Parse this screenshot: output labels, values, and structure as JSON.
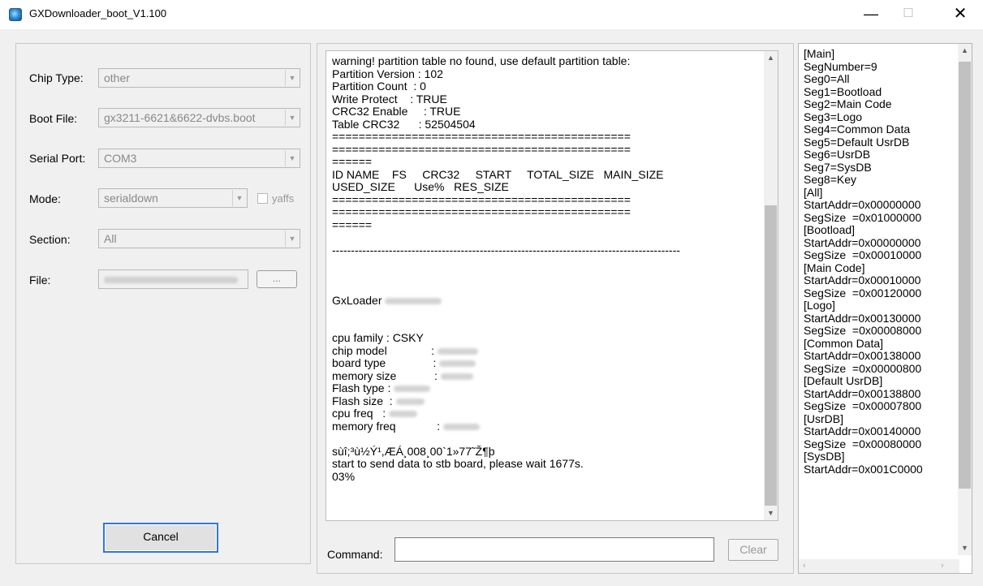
{
  "window": {
    "title": "GXDownloader_boot_V1.100",
    "min_glyph": "—",
    "max_glyph": "☐",
    "close_glyph": "✕"
  },
  "left": {
    "chip_type_label": "Chip Type:",
    "chip_type_value": "other",
    "boot_file_label": "Boot File:",
    "boot_file_value": "gx3211-6621&6622-dvbs.boot",
    "serial_port_label": "Serial Port:",
    "serial_port_value": "COM3",
    "mode_label": "Mode:",
    "mode_value": "serialdown",
    "yaffs_label": "yaffs",
    "section_label": "Section:",
    "section_value": "All",
    "file_label": "File:",
    "browse_label": "...",
    "cancel_label": "Cancel"
  },
  "log": {
    "lines": [
      "warning! partition table no found, use default partition table:",
      "Partition Version : 102",
      "Partition Count  : 0",
      "Write Protect    : TRUE",
      "CRC32 Enable     : TRUE",
      "Table CRC32      : 52504504",
      "=============================================",
      "=============================================",
      "======",
      "ID NAME    FS     CRC32     START     TOTAL_SIZE   MAIN_SIZE",
      "USED_SIZE      Use%   RES_SIZE",
      "=============================================",
      "=============================================",
      "======",
      "",
      "--------------------------------------------------------------------------------------------",
      "",
      "",
      "",
      "GxLoader",
      "",
      "",
      "cpu family : CSKY",
      "chip model              :",
      "board type               :",
      "memory size            :",
      "Flash type :",
      "Flash size  :",
      "cpu freq   :",
      "memory freq             :",
      "",
      "sùî;³ù½Ý¹,ÆÁ¸008¸00`1»77˜Ž¶þ",
      "start to send data to stb board, please wait 1677s.",
      "03%"
    ],
    "command_label": "Command:",
    "clear_label": "Clear"
  },
  "ini": {
    "lines": [
      "[Main]",
      "SegNumber=9",
      "Seg0=All",
      "Seg1=Bootload",
      "Seg2=Main Code",
      "Seg3=Logo",
      "Seg4=Common Data",
      "Seg5=Default UsrDB",
      "Seg6=UsrDB",
      "Seg7=SysDB",
      "Seg8=Key",
      "[All]",
      "StartAddr=0x00000000",
      "SegSize  =0x01000000",
      "[Bootload]",
      "StartAddr=0x00000000",
      "SegSize  =0x00010000",
      "[Main Code]",
      "StartAddr=0x00010000",
      "SegSize  =0x00120000",
      "[Logo]",
      "StartAddr=0x00130000",
      "SegSize  =0x00008000",
      "[Common Data]",
      "StartAddr=0x00138000",
      "SegSize  =0x00000800",
      "[Default UsrDB]",
      "StartAddr=0x00138800",
      "SegSize  =0x00007800",
      "[UsrDB]",
      "StartAddr=0x00140000",
      "SegSize  =0x00080000",
      "[SysDB]",
      "StartAddr=0x001C0000"
    ]
  }
}
